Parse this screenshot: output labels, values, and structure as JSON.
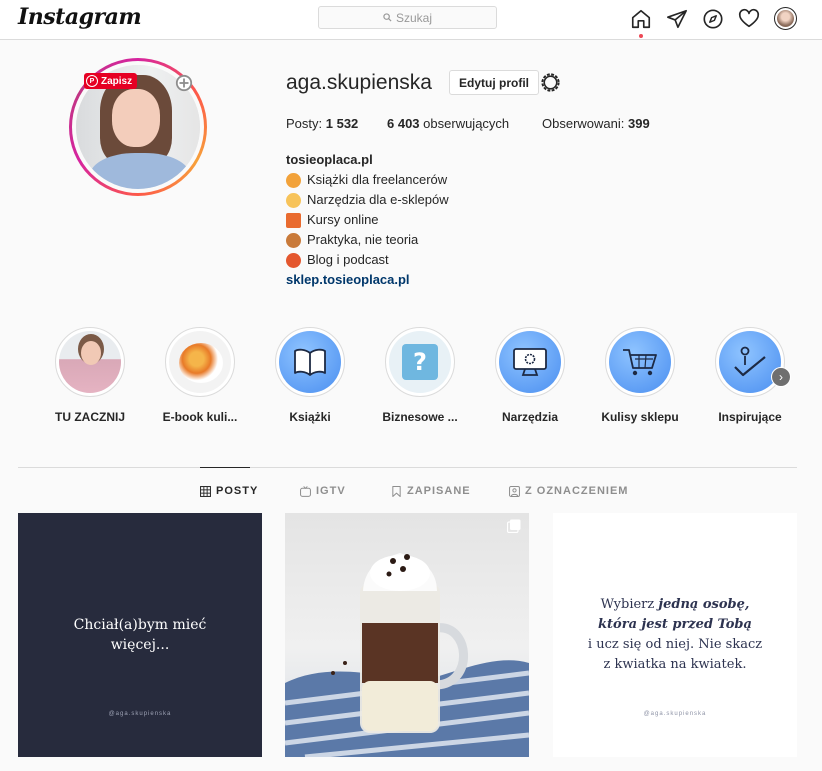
{
  "header": {
    "logo": "Instagram",
    "search_placeholder": "Szukaj",
    "nav": [
      {
        "icon": "home-icon"
      },
      {
        "icon": "direct-icon"
      },
      {
        "icon": "explore-icon"
      },
      {
        "icon": "heart-icon"
      },
      {
        "icon": "avatar"
      }
    ]
  },
  "profile": {
    "username": "aga.skupienska",
    "edit_button": "Edytuj profil",
    "pin_badge": "Zapisz",
    "stats": {
      "posts_label": "Posty:",
      "posts_value": "1 532",
      "followers_value": "6 403",
      "followers_label": "obserwujących",
      "following_label": "Obserwowani:",
      "following_value": "399"
    },
    "bio": {
      "site_name": "tosieoplaca.pl",
      "lines": [
        {
          "emoji_color": "#f2a23a",
          "text": "Książki dla freelancerów"
        },
        {
          "emoji_color": "#f7c35a",
          "text": "Narzędzia dla e-sklepów"
        },
        {
          "emoji_color": "#e96b2f",
          "text": "Kursy online"
        },
        {
          "emoji_color": "#c97a3a",
          "text": "Praktyka, nie teoria"
        },
        {
          "emoji_color": "#e4572e",
          "text": "Blog i podcast"
        }
      ],
      "link": "sklep.tosieoplaca.pl"
    }
  },
  "highlights": [
    {
      "label": "TU ZACZNIJ"
    },
    {
      "label": "E-book kuli..."
    },
    {
      "label": "Książki"
    },
    {
      "label": "Biznesowe ..."
    },
    {
      "label": "Narzędzia"
    },
    {
      "label": "Kulisy sklepu"
    },
    {
      "label": "Inspirujące"
    }
  ],
  "tabs": [
    {
      "label": "POSTY",
      "icon": "grid-icon",
      "active": true
    },
    {
      "label": "IGTV",
      "icon": "igtv-icon",
      "active": false
    },
    {
      "label": "ZAPISANE",
      "icon": "bookmark-icon",
      "active": false
    },
    {
      "label": "Z OZNACZENIEM",
      "icon": "tagged-icon",
      "active": false
    }
  ],
  "posts": {
    "post1": {
      "text_line1": "Chciał(a)bym mieć",
      "text_line2": "więcej...",
      "handle": "@aga.skupienska"
    },
    "post3": {
      "line1_a": "Wybierz ",
      "line1_b": "jedną osobę,",
      "line2": "która jest przed Tobą",
      "line3": "i ucz się od niej. Nie skacz",
      "line4": "z kwiatka na kwiatek.",
      "handle": "@aga.skupienska"
    }
  },
  "colors": {
    "accent_link": "#00376b",
    "pinterest": "#e60023",
    "notification": "#ed4956"
  }
}
